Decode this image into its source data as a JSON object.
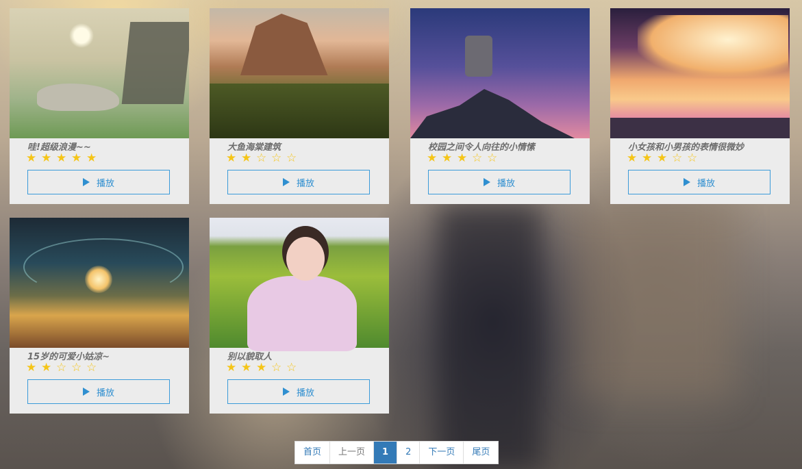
{
  "videos": [
    {
      "title": "哇!超级浪漫~~",
      "rating": 5,
      "stars": [
        "★",
        "★",
        "★",
        "★",
        "★"
      ],
      "button_label": "播放"
    },
    {
      "title": "大鱼海棠建筑",
      "rating": 2,
      "stars": [
        "★",
        "★",
        "☆",
        "☆",
        "☆"
      ],
      "button_label": "播放"
    },
    {
      "title": "校园之间令人向往的小情愫",
      "rating": 3,
      "stars": [
        "★",
        "★",
        "★",
        "☆",
        "☆"
      ],
      "button_label": "播放"
    },
    {
      "title": "小女孩和小男孩的表情很微妙",
      "rating": 3,
      "stars": [
        "★",
        "★",
        "★",
        "☆",
        "☆"
      ],
      "button_label": "播放"
    },
    {
      "title": "15岁的可爱小姑凉~",
      "rating": 2,
      "stars": [
        "★",
        "★",
        "☆",
        "☆",
        "☆"
      ],
      "button_label": "播放"
    },
    {
      "title": "别以貌取人",
      "rating": 3,
      "stars": [
        "★",
        "★",
        "★",
        "☆",
        "☆"
      ],
      "button_label": "播放"
    }
  ],
  "pagination": {
    "first": "首页",
    "prev": "上一页",
    "pages": [
      "1",
      "2"
    ],
    "current": "1",
    "next": "下一页",
    "last": "尾页"
  },
  "colors": {
    "accent": "#337ab7",
    "button_border": "#3a9ad9",
    "star": "#f5c518",
    "card_bg": "#ececec"
  },
  "icons": {
    "play": "play-icon",
    "star": "star-icon"
  }
}
